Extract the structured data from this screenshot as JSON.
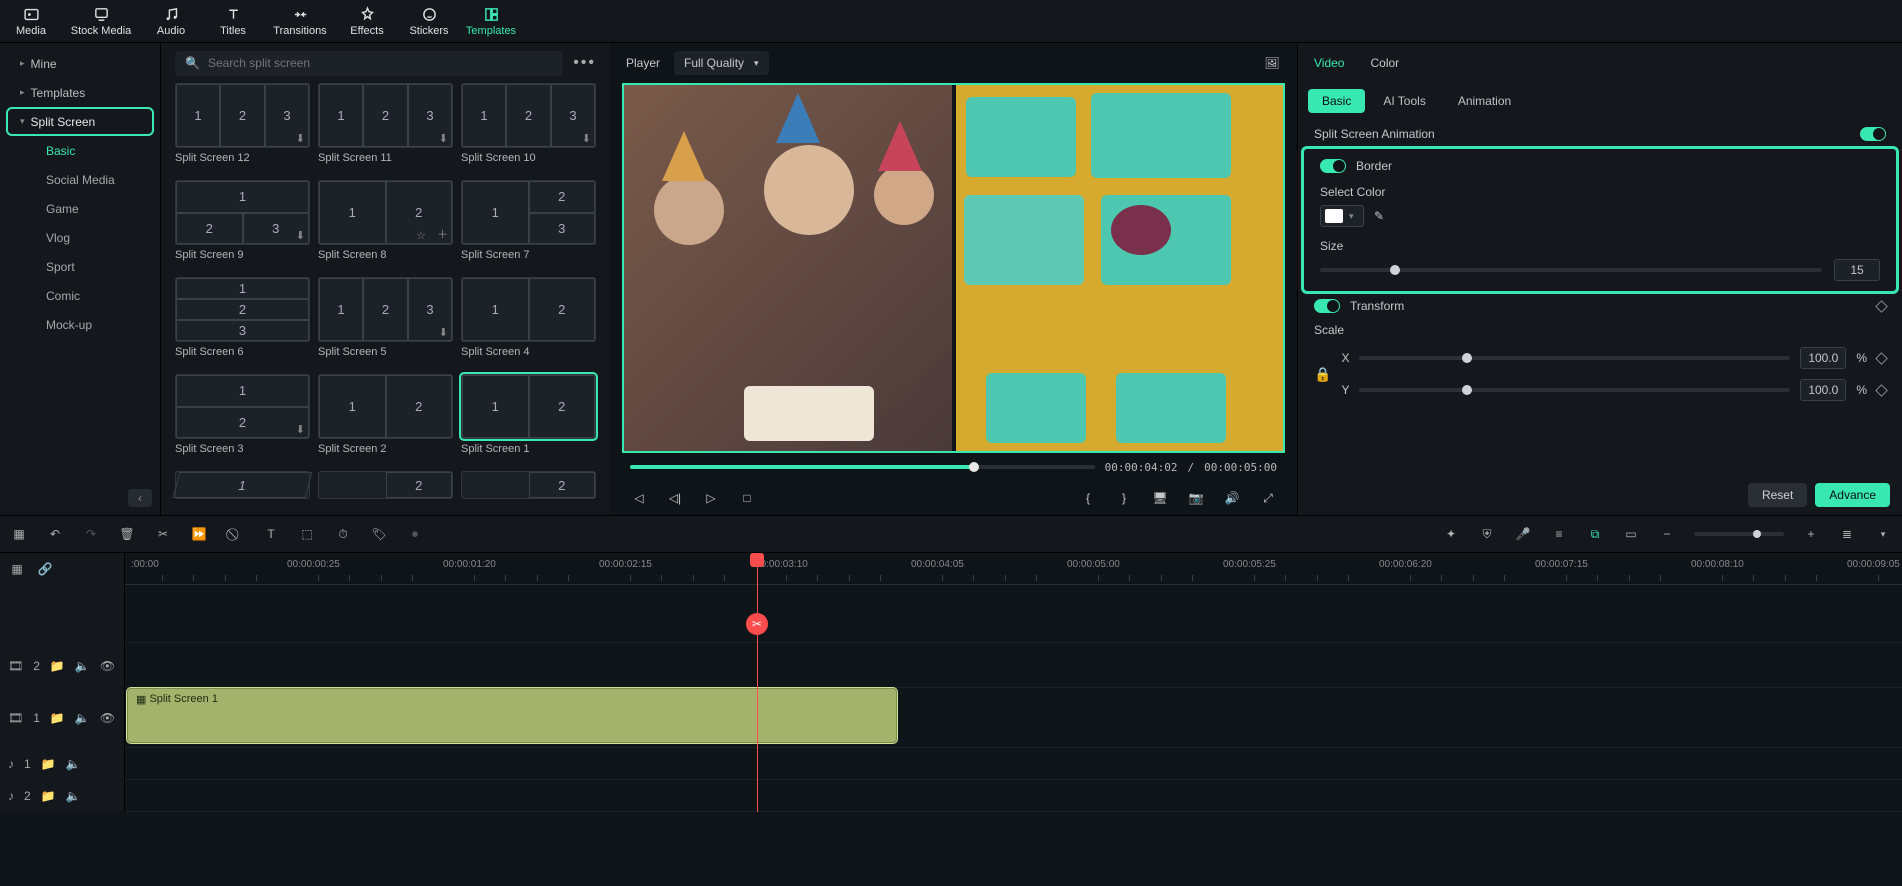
{
  "topTabs": [
    {
      "key": "media",
      "label": "Media"
    },
    {
      "key": "stock",
      "label": "Stock Media"
    },
    {
      "key": "audio",
      "label": "Audio"
    },
    {
      "key": "titles",
      "label": "Titles"
    },
    {
      "key": "transitions",
      "label": "Transitions"
    },
    {
      "key": "effects",
      "label": "Effects"
    },
    {
      "key": "stickers",
      "label": "Stickers"
    },
    {
      "key": "templates",
      "label": "Templates",
      "active": true
    }
  ],
  "sidebar": {
    "mine": "Mine",
    "templates": "Templates",
    "splitScreen": "Split Screen",
    "subs": [
      "Basic",
      "Social Media",
      "Game",
      "Vlog",
      "Sport",
      "Comic",
      "Mock-up"
    ]
  },
  "search": {
    "placeholder": "Search split screen"
  },
  "templates": [
    {
      "label": "Split Screen 12"
    },
    {
      "label": "Split Screen 11"
    },
    {
      "label": "Split Screen 10"
    },
    {
      "label": "Split Screen 9"
    },
    {
      "label": "Split Screen 8"
    },
    {
      "label": "Split Screen 7"
    },
    {
      "label": "Split Screen 6"
    },
    {
      "label": "Split Screen 5"
    },
    {
      "label": "Split Screen 4"
    },
    {
      "label": "Split Screen 3"
    },
    {
      "label": "Split Screen 2"
    },
    {
      "label": "Split Screen 1",
      "selected": true
    }
  ],
  "player": {
    "title": "Player",
    "quality": "Full Quality",
    "current": "00:00:04:02",
    "sep": "/",
    "total": "00:00:05:00"
  },
  "right": {
    "tabs": {
      "video": "Video",
      "color": "Color"
    },
    "subtabs": {
      "basic": "Basic",
      "ai": "AI Tools",
      "anim": "Animation"
    },
    "splitAnim": "Split Screen Animation",
    "border": {
      "title": "Border",
      "selectColor": "Select Color",
      "size": "Size",
      "sizeVal": "15"
    },
    "transform": {
      "title": "Transform",
      "scale": "Scale",
      "x": "X",
      "y": "Y",
      "xv": "100.0",
      "yv": "100.0",
      "pct": "%"
    },
    "reset": "Reset",
    "advance": "Advance"
  },
  "ruler": [
    ":00:00",
    "00:00:00:25",
    "00:00:01:20",
    "00:00:02:15",
    "00:00:03:10",
    "00:00:04:05",
    "00:00:05:00",
    "00:00:05:25",
    "00:00:06:20",
    "00:00:07:15",
    "00:00:08:10",
    "00:00:09:05"
  ],
  "clip": {
    "label": "Split Screen 1"
  },
  "trackLabels": {
    "v2": "2",
    "v1": "1",
    "a1": "1",
    "a2": "2"
  }
}
